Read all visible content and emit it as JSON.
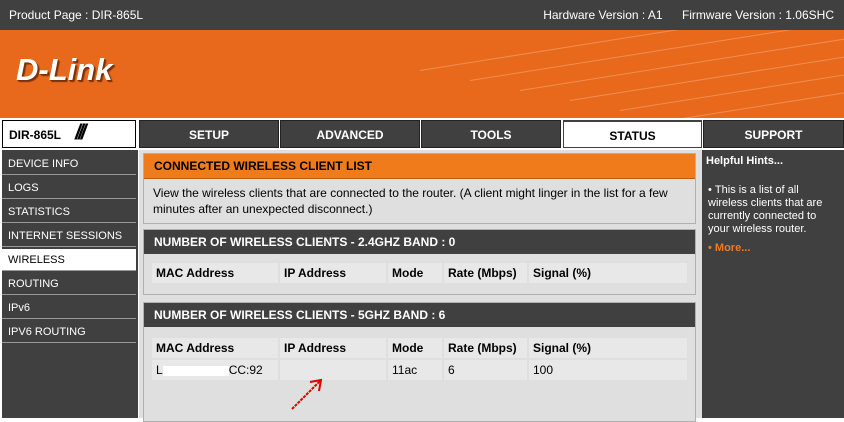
{
  "topbar": {
    "product": "Product Page : DIR-865L",
    "hardware": "Hardware Version : A1",
    "firmware": "Firmware Version : 1.06SHC"
  },
  "brand": {
    "logo": "D-Link",
    "model": "DIR-865L"
  },
  "tabs": [
    {
      "label": "SETUP"
    },
    {
      "label": "ADVANCED"
    },
    {
      "label": "TOOLS"
    },
    {
      "label": "STATUS",
      "active": true
    },
    {
      "label": "SUPPORT"
    }
  ],
  "sidebar": [
    {
      "label": "DEVICE INFO"
    },
    {
      "label": "LOGS"
    },
    {
      "label": "STATISTICS"
    },
    {
      "label": "INTERNET SESSIONS"
    },
    {
      "label": "WIRELESS",
      "active": true
    },
    {
      "label": "ROUTING"
    },
    {
      "label": "IPv6"
    },
    {
      "label": "IPV6 ROUTING"
    }
  ],
  "intro": {
    "title": "CONNECTED WIRELESS CLIENT LIST",
    "text": "View the wireless clients that are connected to the router. (A client might linger in the list for a few minutes after an unexpected disconnect.)"
  },
  "band24": {
    "title": "NUMBER OF WIRELESS CLIENTS - 2.4GHZ BAND : 0",
    "columns": [
      "MAC Address",
      "IP Address",
      "Mode",
      "Rate (Mbps)",
      "Signal (%)"
    ]
  },
  "band5": {
    "title": "NUMBER OF WIRELESS CLIENTS - 5GHZ BAND : 6",
    "columns": [
      "MAC Address",
      "IP Address",
      "Mode",
      "Rate (Mbps)",
      "Signal (%)"
    ],
    "rows": [
      {
        "mac_prefix": "L",
        "mac_suffix": "CC:92",
        "ip": "",
        "mode": "11ac",
        "rate": "6",
        "signal": "100"
      }
    ]
  },
  "hints": {
    "title": "Helpful Hints...",
    "text": "This is a list of all wireless clients that are currently connected to your wireless router.",
    "more": "More..."
  },
  "colors": {
    "accent": "#f07b1a",
    "dark": "#404040",
    "panel": "#dfdfdf",
    "annotation": "#e00000"
  }
}
